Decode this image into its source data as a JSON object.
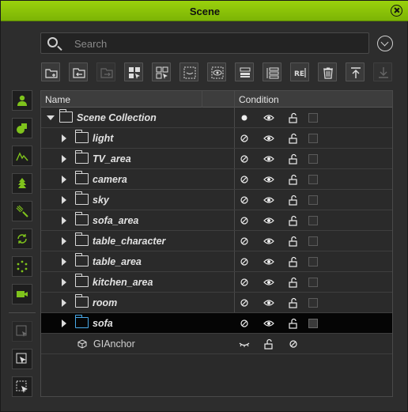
{
  "window": {
    "title": "Scene"
  },
  "search": {
    "placeholder": "Search"
  },
  "columns": {
    "name": "Name",
    "condition": "Condition"
  },
  "tree": {
    "root": {
      "label": "Scene Collection"
    },
    "items": [
      {
        "label": "light"
      },
      {
        "label": "TV_area"
      },
      {
        "label": "camera"
      },
      {
        "label": "sky"
      },
      {
        "label": "sofa_area"
      },
      {
        "label": "table_character"
      },
      {
        "label": "table_area"
      },
      {
        "label": "kitchen_area"
      },
      {
        "label": "room"
      },
      {
        "label": "sofa",
        "selected": true
      }
    ],
    "anchor": {
      "label": "GIAnchor"
    }
  },
  "colors": {
    "title_bar": "#8cc40a",
    "selected_row": "#050505",
    "sidebar_accent": "#7fc31c",
    "sofa_folder": "#4aa9e8"
  }
}
